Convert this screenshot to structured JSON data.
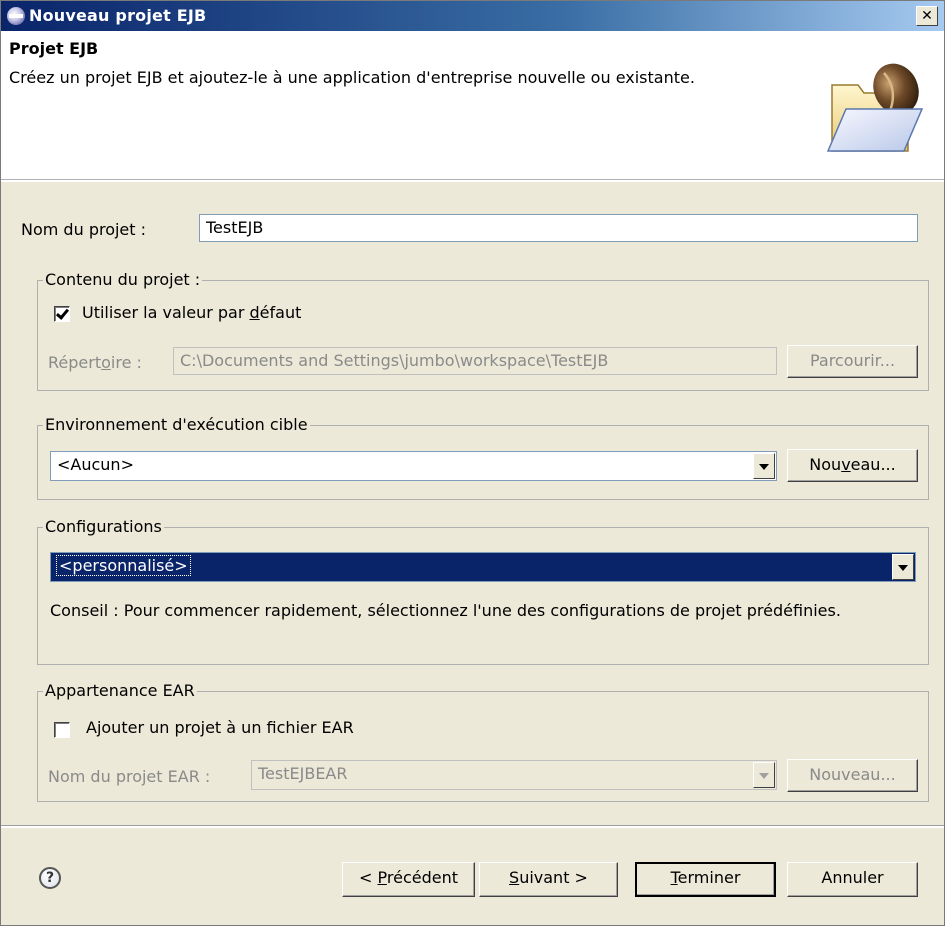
{
  "window": {
    "title": "Nouveau projet EJB",
    "close_symbol": "✕"
  },
  "header": {
    "heading": "Projet EJB",
    "description": "Créez un projet EJB et ajoutez-le à une application d'entreprise nouvelle ou existante.",
    "icon": "folder-bean-icon"
  },
  "project_name": {
    "label": "Nom du projet :",
    "value": "TestEJB"
  },
  "content_group": {
    "legend": "Contenu du projet :",
    "use_default_prefix": "Utiliser la valeur par ",
    "use_default_mnemonic": "d",
    "use_default_suffix": "éfaut",
    "use_default_checked": true,
    "directory_prefix": "Répert",
    "directory_mnemonic": "o",
    "directory_suffix": "ire :",
    "directory_value": "C:\\Documents and Settings\\jumbo\\workspace\\TestEJB",
    "browse_label": "Parcourir..."
  },
  "runtime_group": {
    "legend": "Environnement d'exécution cible",
    "selected": "<Aucun>",
    "new_prefix": "Nou",
    "new_mnemonic": "v",
    "new_suffix": "eau..."
  },
  "config_group": {
    "legend": "Configurations",
    "selected": "<personnalisé>",
    "hint": "Conseil : Pour commencer rapidement, sélectionnez l'une des configurations de projet prédéfinies."
  },
  "ear_group": {
    "legend": "Appartenance EAR",
    "add_label": "Ajouter un projet à un fichier EAR",
    "add_checked": false,
    "ear_name_label": "Nom du projet EAR :",
    "ear_name_value": "TestEJBEAR",
    "new_label": "Nouveau..."
  },
  "footer": {
    "help_symbol": "?",
    "back_prefix": "< ",
    "back_mnemonic": "P",
    "back_suffix": "récédent",
    "next_mnemonic": "S",
    "next_suffix": "uivant >",
    "finish_mnemonic": "T",
    "finish_suffix": "erminer",
    "cancel_label": "Annuler"
  },
  "colors": {
    "title_bar": "#0a246a",
    "selection": "#0a246a",
    "dialog_bg": "#ece9d8"
  }
}
